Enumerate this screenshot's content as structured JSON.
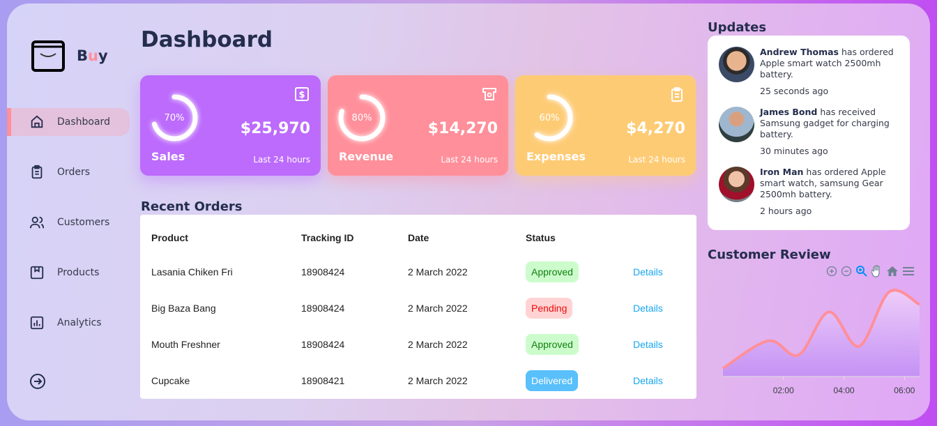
{
  "brand": {
    "name_b": "B",
    "name_u": "u",
    "name_y": "y"
  },
  "sidebar": {
    "items": [
      {
        "label": "Dashboard",
        "icon": "home-icon",
        "active": true
      },
      {
        "label": "Orders",
        "icon": "clipboard-icon"
      },
      {
        "label": "Customers",
        "icon": "users-icon"
      },
      {
        "label": "Products",
        "icon": "bookmark-box-icon"
      },
      {
        "label": "Analytics",
        "icon": "bar-chart-icon"
      }
    ],
    "logout_icon": "logout-icon"
  },
  "header": {
    "title": "Dashboard"
  },
  "cards": [
    {
      "label": "Sales",
      "percent": "70%",
      "progress": 0.7,
      "amount": "$25,970",
      "sub": "Last 24 hours",
      "color": "#bc6bfc",
      "icon": "dollar-icon"
    },
    {
      "label": "Revenue",
      "percent": "80%",
      "progress": 0.8,
      "amount": "$14,270",
      "sub": "Last 24 hours",
      "color": "#ff8f9a",
      "icon": "atm-icon"
    },
    {
      "label": "Expenses",
      "percent": "60%",
      "progress": 0.6,
      "amount": "$4,270",
      "sub": "Last 24 hours",
      "color": "#fecb75",
      "icon": "clipboard-icon"
    }
  ],
  "recent_orders": {
    "title": "Recent Orders",
    "headers": [
      "Product",
      "Tracking ID",
      "Date",
      "Status"
    ],
    "rows": [
      {
        "product": "Lasania Chiken Fri",
        "tracking": "18908424",
        "date": "2 March 2022",
        "status": "Approved",
        "action": "Details"
      },
      {
        "product": "Big Baza Bang",
        "tracking": "18908424",
        "date": "2 March 2022",
        "status": "Pending",
        "action": "Details"
      },
      {
        "product": "Mouth Freshner",
        "tracking": "18908424",
        "date": "2 March 2022",
        "status": "Approved",
        "action": "Details"
      },
      {
        "product": "Cupcake",
        "tracking": "18908421",
        "date": "2 March 2022",
        "status": "Delivered",
        "action": "Details"
      }
    ]
  },
  "updates": {
    "title": "Updates",
    "items": [
      {
        "name": "Andrew Thomas",
        "text": "has ordered Apple smart watch 2500mh battery.",
        "time": "25 seconds ago"
      },
      {
        "name": "James Bond",
        "text": "has received Samsung gadget for charging battery.",
        "time": "30 minutes ago"
      },
      {
        "name": "Iron Man",
        "text": "has ordered Apple smart watch, samsung Gear 2500mh battery.",
        "time": "2 hours ago"
      }
    ]
  },
  "chart_data": {
    "type": "area",
    "title": "Customer Review",
    "x": [
      0,
      1.5,
      2.5,
      3.5,
      4.5,
      5.5,
      6.5
    ],
    "values": [
      12,
      53,
      32,
      96,
      45,
      126,
      107
    ],
    "xticks": [
      "02:00",
      "04:00",
      "06:00"
    ],
    "xlim": [
      0,
      6.5
    ],
    "ylim": [
      0,
      140
    ],
    "grid": false,
    "line_color": "#ff8f9a",
    "fill_color": "#c18ff5",
    "toolbar": [
      "zoom-in-icon",
      "zoom-out-icon",
      "selection-zoom-icon",
      "pan-hand-icon",
      "reset-home-icon",
      "menu-icon"
    ]
  }
}
